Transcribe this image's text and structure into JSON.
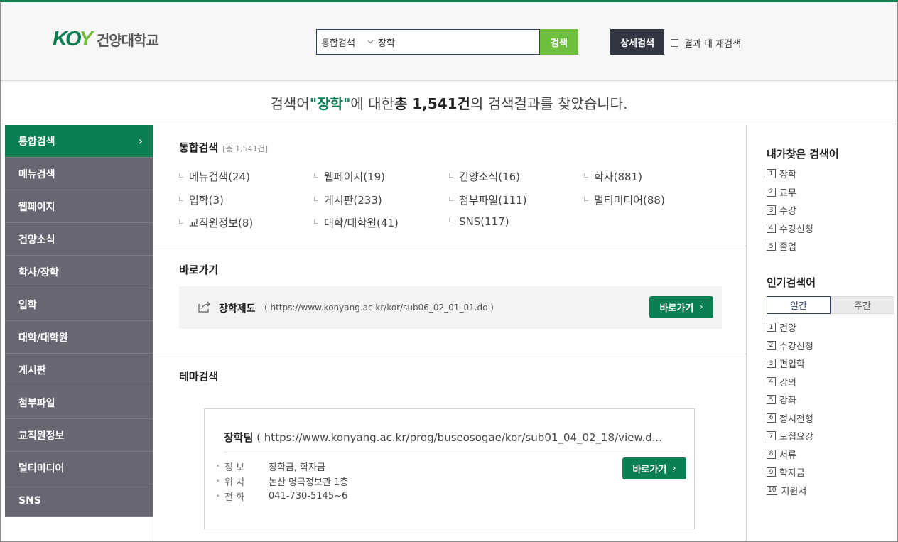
{
  "header": {
    "logo_mark_k": "K",
    "logo_mark_o": "O",
    "logo_mark_y": "Y",
    "logo_text": "건양대학교",
    "search_scope": "통합검색",
    "search_value": "장학",
    "search_button": "검색",
    "advanced_button": "상세검색",
    "research_label": "결과 내 재검색"
  },
  "summary": {
    "prefix": "검색어 ",
    "keyword": "\"장학\"",
    "middle": "에 대한 ",
    "total_label": "총 1,541건",
    "suffix": "의 검색결과를 찾았습니다."
  },
  "leftnav": {
    "items": [
      {
        "label": "통합검색"
      },
      {
        "label": "메뉴검색"
      },
      {
        "label": "웹페이지"
      },
      {
        "label": "건양소식"
      },
      {
        "label": "학사/장학"
      },
      {
        "label": "입학"
      },
      {
        "label": "대학/대학원"
      },
      {
        "label": "게시판"
      },
      {
        "label": "첨부파일"
      },
      {
        "label": "교직원정보"
      },
      {
        "label": "멀티미디어"
      },
      {
        "label": "SNS"
      }
    ],
    "active_arrow": "›"
  },
  "categories": {
    "title": "통합검색",
    "subtitle": "[총 1,541건]",
    "items": [
      {
        "label": "메뉴검색(24)"
      },
      {
        "label": "웹페이지(19)"
      },
      {
        "label": "건양소식(16)"
      },
      {
        "label": "학사(881)"
      },
      {
        "label": "입학(3)"
      },
      {
        "label": "게시판(233)"
      },
      {
        "label": "첨부파일(111)"
      },
      {
        "label": "멀티미디어(88)"
      },
      {
        "label": "교직원정보(8)"
      },
      {
        "label": "대학/대학원(41)"
      },
      {
        "label": "SNS(117)"
      }
    ]
  },
  "shortcut": {
    "title": "바로가기",
    "name": "장학제도",
    "url": "( https://www.konyang.ac.kr/kor/sub06_02_01_01.do )",
    "button": "바로가기",
    "button_arrow": "›"
  },
  "theme": {
    "title": "테마검색",
    "card_name": "장학팀",
    "card_url": " ( https://www.konyang.ac.kr/prog/buseosogae/kor/sub01_04_02_18/view.d...",
    "rows": [
      {
        "key": "정 보",
        "value": "장학금, 학자금"
      },
      {
        "key": "위 치",
        "value": "논산 명곡정보관 1층"
      },
      {
        "key": "전 화",
        "value": "041-730-5145~6"
      }
    ],
    "bullet": "•",
    "button": "바로가기",
    "button_arrow": "›"
  },
  "my_searches": {
    "title": "내가찾은 검색어",
    "items": [
      {
        "n": "1",
        "label": "장학"
      },
      {
        "n": "2",
        "label": "교무"
      },
      {
        "n": "3",
        "label": "수강"
      },
      {
        "n": "4",
        "label": "수강신청"
      },
      {
        "n": "5",
        "label": "졸업"
      }
    ]
  },
  "popular": {
    "title": "인기검색어",
    "tab_daily": "일간",
    "tab_weekly": "주간",
    "items": [
      {
        "n": "1",
        "label": "건양"
      },
      {
        "n": "2",
        "label": "수강신청"
      },
      {
        "n": "3",
        "label": "편입학"
      },
      {
        "n": "4",
        "label": "강의"
      },
      {
        "n": "5",
        "label": "강좌"
      },
      {
        "n": "6",
        "label": "정시전형"
      },
      {
        "n": "7",
        "label": "모집요강"
      },
      {
        "n": "8",
        "label": "서류"
      },
      {
        "n": "9",
        "label": "학자금"
      },
      {
        "n": "10",
        "label": "지원서"
      }
    ]
  },
  "colors": {
    "brand_green": "#0a7f51",
    "search_green": "#6fbf3e",
    "nav_gray": "#686672",
    "navy": "#2c3e6d"
  }
}
